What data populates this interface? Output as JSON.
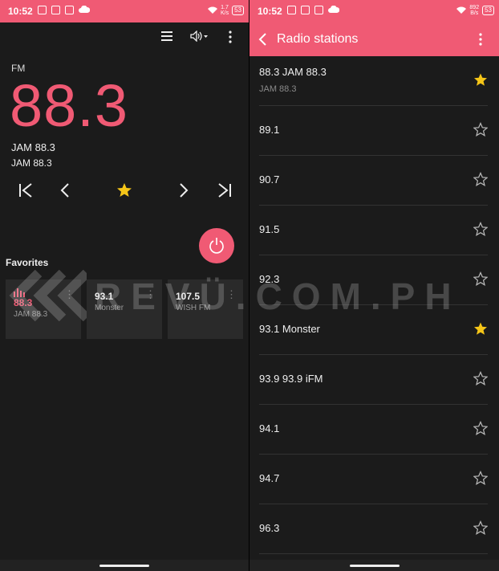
{
  "left": {
    "status": {
      "time": "10:52",
      "speed_top": "1.7",
      "speed_bottom": "K/s",
      "battery": "53"
    },
    "band": "FM",
    "frequency": "88.3",
    "station_name": "JAM 88.3",
    "rds_text": "JAM 88.3",
    "favorites_title": "Favorites",
    "favorites": [
      {
        "freq": "88.3",
        "name": "JAM 88.3"
      },
      {
        "freq": "93.1",
        "name": "Monster"
      },
      {
        "freq": "107.5",
        "name": "WISH FM"
      }
    ]
  },
  "right": {
    "status": {
      "time": "10:52",
      "speed_top": "892",
      "speed_bottom": "B/s",
      "battery": "53"
    },
    "title": "Radio stations",
    "stations": [
      {
        "title": "88.3  JAM 88.3",
        "sub": "JAM 88.3",
        "favorite": true
      },
      {
        "title": "89.1",
        "sub": "",
        "favorite": false
      },
      {
        "title": "90.7",
        "sub": "",
        "favorite": false
      },
      {
        "title": "91.5",
        "sub": "",
        "favorite": false
      },
      {
        "title": "92.3",
        "sub": "",
        "favorite": false
      },
      {
        "title": "93.1  Monster",
        "sub": "",
        "favorite": true
      },
      {
        "title": "93.9  93.9 iFM",
        "sub": "",
        "favorite": false
      },
      {
        "title": "94.1",
        "sub": "",
        "favorite": false
      },
      {
        "title": "94.7",
        "sub": "",
        "favorite": false
      },
      {
        "title": "96.3",
        "sub": "",
        "favorite": false
      }
    ]
  },
  "watermark": "REVÜ.COM.PH",
  "colors": {
    "accent": "#f05a74",
    "star": "#f5c518",
    "background": "#1b1b1b"
  }
}
